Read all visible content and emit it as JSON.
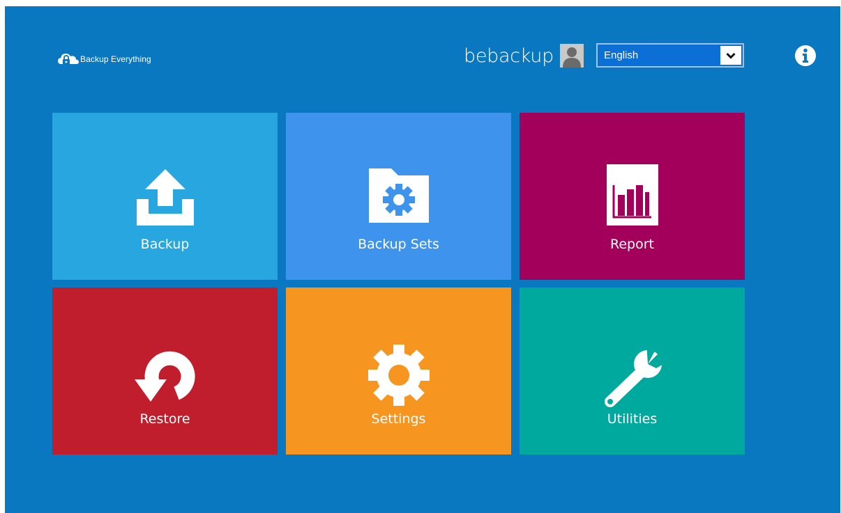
{
  "header": {
    "brand": "Backup Everything",
    "username": "bebackup",
    "language": {
      "selected": "English",
      "options": [
        "English"
      ]
    }
  },
  "colors": {
    "background": "#0a78c1",
    "backup": "#27a6e0",
    "backup_sets": "#3e93ec",
    "report": "#a2005a",
    "restore": "#c01e2c",
    "settings": "#f6951f",
    "utilities": "#00a99d"
  },
  "tiles": [
    {
      "label": "Backup",
      "icon": "upload-icon"
    },
    {
      "label": "Backup Sets",
      "icon": "folder-gear-icon"
    },
    {
      "label": "Report",
      "icon": "bar-chart-icon"
    },
    {
      "label": "Restore",
      "icon": "undo-icon"
    },
    {
      "label": "Settings",
      "icon": "gear-icon"
    },
    {
      "label": "Utilities",
      "icon": "wrench-icon"
    }
  ]
}
